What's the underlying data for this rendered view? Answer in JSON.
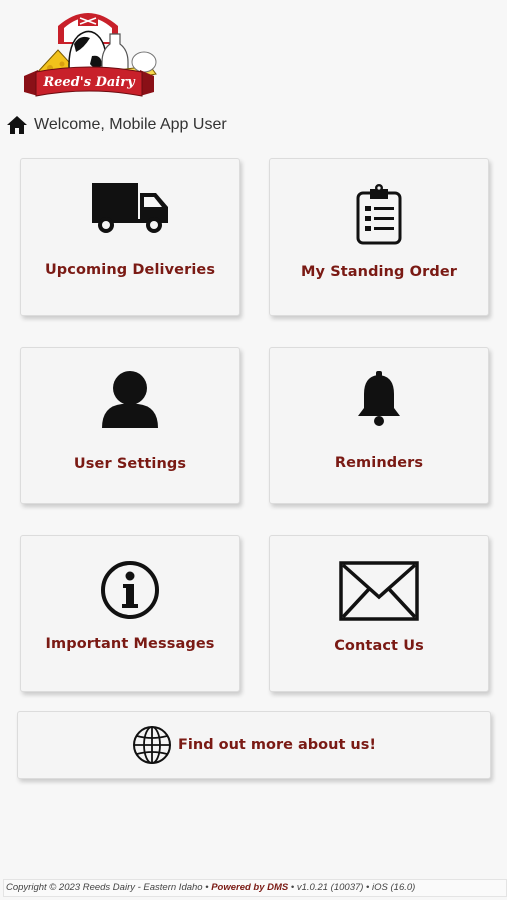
{
  "brand": {
    "logo_text": "Reed's Dairy"
  },
  "header": {
    "welcome": "Welcome, Mobile App User"
  },
  "tiles": [
    {
      "label": "Upcoming Deliveries",
      "icon": "truck-icon"
    },
    {
      "label": "My Standing Order",
      "icon": "clipboard-list-icon"
    },
    {
      "label": "User Settings",
      "icon": "user-icon"
    },
    {
      "label": "Reminders",
      "icon": "bell-icon"
    },
    {
      "label": "Important Messages",
      "icon": "info-icon"
    },
    {
      "label": "Contact Us",
      "icon": "envelope-icon"
    }
  ],
  "about": {
    "label": "Find out more about us!",
    "icon": "globe-icon"
  },
  "footer": {
    "copyright": "Copyright © 2023 Reeds Dairy - Eastern Idaho •",
    "powered": "Powered by DMS",
    "version": "• v1.0.21 (10037) • iOS (16.0)"
  },
  "colors": {
    "accent": "#7a1a14",
    "background": "#f7f7f7",
    "tile": "#f5f5f5"
  }
}
